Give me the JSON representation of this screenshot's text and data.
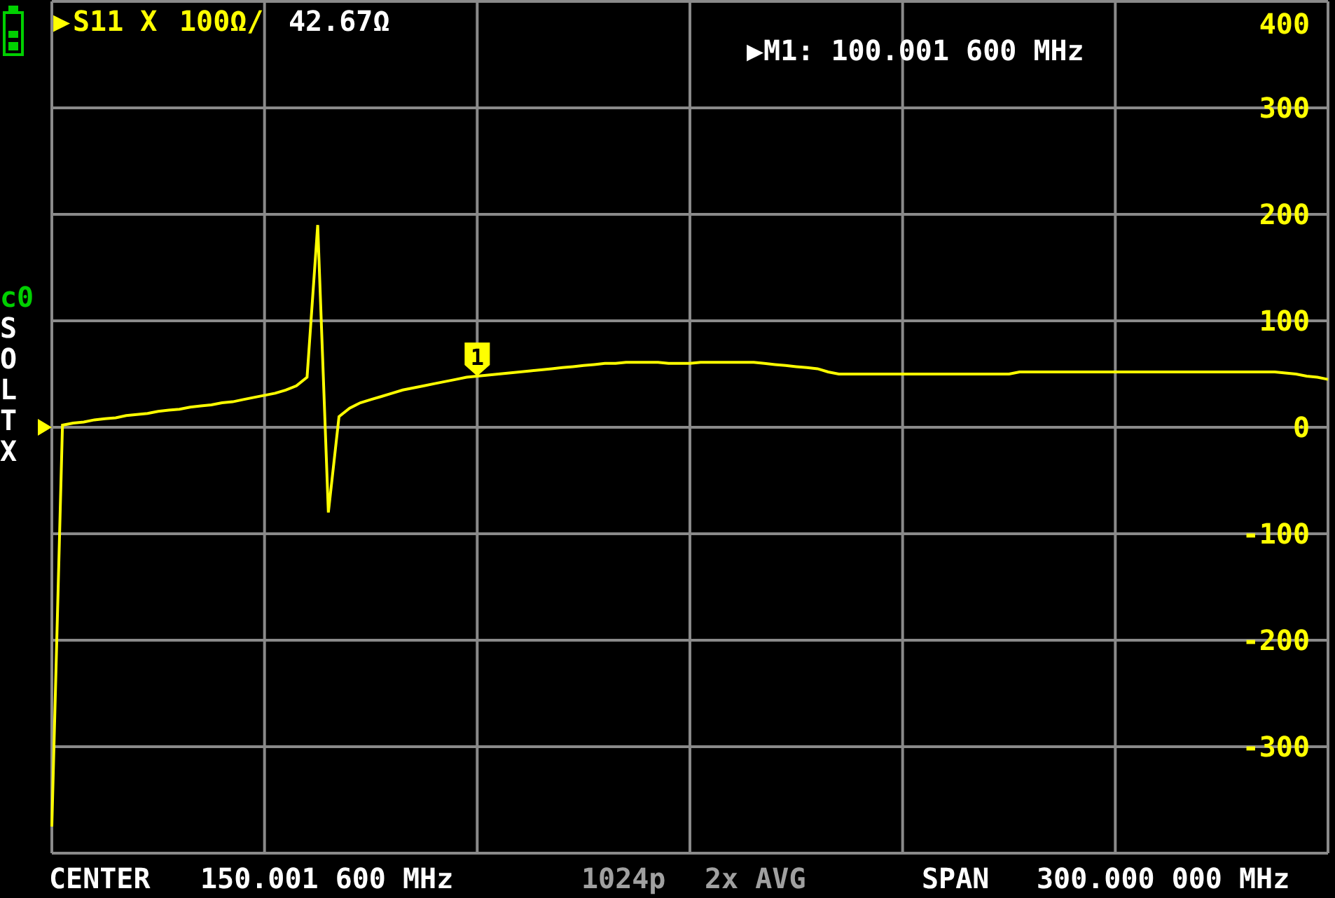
{
  "header": {
    "trace_arrow": "▶",
    "trace_scale": "100Ω/",
    "trace_value": "42.67Ω",
    "marker_readout": "▶M1: 100.001 600 MHz"
  },
  "calibration": {
    "status": "c0",
    "flags": [
      "S",
      "O",
      "L",
      "T",
      "X"
    ]
  },
  "top_scale_label": "400",
  "chart_data": {
    "type": "line",
    "grid": true,
    "ylim": [
      -400,
      400
    ],
    "yticks": [
      300,
      200,
      100,
      0,
      -100,
      -200,
      -300
    ],
    "categories": [
      null,
      null,
      null,
      null,
      null,
      null,
      null,
      null,
      null,
      null,
      null,
      null,
      null,
      null,
      null,
      null,
      null,
      null,
      null,
      null,
      null,
      null,
      null,
      null,
      null,
      null,
      null,
      null,
      null,
      null,
      null,
      null,
      null,
      null,
      null,
      null,
      null,
      null,
      null,
      null,
      null,
      null,
      null,
      null,
      null,
      null,
      null,
      null,
      null,
      null,
      null,
      null,
      null,
      null,
      null,
      null,
      null,
      null,
      null,
      null,
      null,
      null,
      null,
      null,
      null,
      null,
      null,
      null,
      null,
      null,
      null,
      null,
      null,
      null,
      null,
      null,
      null,
      null,
      null,
      null,
      null,
      null,
      null,
      null,
      null,
      null,
      null,
      null,
      null,
      null,
      null,
      null,
      null,
      null,
      null,
      null,
      null,
      null,
      null,
      null,
      null,
      null,
      null,
      null,
      null,
      null,
      null,
      null,
      null,
      null,
      null,
      null,
      null,
      null,
      null,
      null,
      null,
      null,
      null,
      null,
      null
    ],
    "series": [
      {
        "name": "S11 X",
        "color": "#ffff00",
        "values": [
          -375,
          2,
          4,
          5,
          7,
          8,
          9,
          11,
          12,
          13,
          15,
          16,
          17,
          19,
          20,
          21,
          23,
          24,
          26,
          28,
          30,
          32,
          35,
          39,
          47,
          190,
          -80,
          10,
          18,
          23,
          26,
          29,
          32,
          35,
          37,
          39,
          41,
          43,
          45,
          47,
          48,
          49,
          50,
          51,
          52,
          53,
          54,
          55,
          56,
          57,
          58,
          59,
          60,
          60,
          61,
          61,
          61,
          61,
          60,
          60,
          60,
          61,
          61,
          61,
          61,
          61,
          61,
          60,
          59,
          58,
          57,
          56,
          55,
          52,
          50,
          50,
          50,
          50,
          50,
          50,
          50,
          50,
          50,
          50,
          50,
          50,
          50,
          50,
          50,
          50,
          50,
          52,
          52,
          52,
          52,
          52,
          52,
          52,
          52,
          52,
          52,
          52,
          52,
          52,
          52,
          52,
          52,
          52,
          52,
          52,
          52,
          52,
          52,
          52,
          52,
          52,
          51,
          50,
          48,
          47,
          45
        ]
      }
    ],
    "annotations": [
      {
        "y": 48,
        "text": "1"
      }
    ]
  },
  "footer": {
    "center_label": "CENTER",
    "center_value": "150.001 600 MHz",
    "points": "1024p",
    "averaging": "2x AVG",
    "span_label": "SPAN",
    "span_value": "300.000 000 MHz"
  }
}
